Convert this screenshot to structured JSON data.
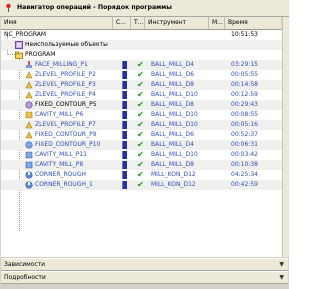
{
  "window": {
    "title": "Навигатор операций - Порядок программы"
  },
  "columns": {
    "name": "Имя",
    "status": "С...",
    "path": "Т...",
    "tool": "Инструмент",
    "method": "М...",
    "time": "Время"
  },
  "root": {
    "name": "NC_PROGRAM",
    "time": "10:51:53"
  },
  "unused": {
    "name": "Неиспользуемые объекты"
  },
  "program": {
    "name": "PROGRAM"
  },
  "operations": [
    {
      "name": "FACE_MILLING_P1",
      "tool": "BALL_MILL_D4",
      "time": "03:29:15"
    },
    {
      "name": "ZLEVEL_PROFILE_P2",
      "tool": "BALL_MILL_D6",
      "time": "00:05:55"
    },
    {
      "name": "ZLEVEL_PROFILE_P3",
      "tool": "BALL_MILL_D8",
      "time": "00:14:58"
    },
    {
      "name": "ZLEVEL_PROFILE_P4",
      "tool": "BALL_MILL_D10",
      "time": "00:12:59"
    },
    {
      "name": "FIXED_CONTOUR_P5",
      "tool": "BALL_MILL_D8",
      "time": "00:29:43"
    },
    {
      "name": "CAVITY_MILL_P6",
      "tool": "BALL_MILL_D10",
      "time": "00:08:55"
    },
    {
      "name": "ZLEVEL_PROFILE_P7",
      "tool": "BALL_MILL_D10",
      "time": "00:05:16"
    },
    {
      "name": "FIXED_CONTOUR_P9",
      "tool": "BALL_MILL_D6",
      "time": "00:52:37"
    },
    {
      "name": "FIXED_CONTOUR_P10",
      "tool": "BALL_MILL_D4",
      "time": "00:06:31"
    },
    {
      "name": "CAVITY_MILL_P11",
      "tool": "BALL_MILL_D10",
      "time": "00:03:42"
    },
    {
      "name": "CAVITY_MILL_P8",
      "tool": "BALL_MILL_D8",
      "time": "00:10:38"
    },
    {
      "name": "CORNER_ROUGH",
      "tool": "MILL_KON_D12",
      "time": "04:25:34"
    },
    {
      "name": "CORNER_ROUGH_1",
      "tool": "MILL_KON_D12",
      "time": "00:42:59"
    }
  ],
  "panels": {
    "dependencies": "Зависимости",
    "details": "Подробности"
  },
  "colors": {
    "link": "#2f4fbf",
    "check": "#1a9a1a",
    "book": "#2233a0"
  }
}
